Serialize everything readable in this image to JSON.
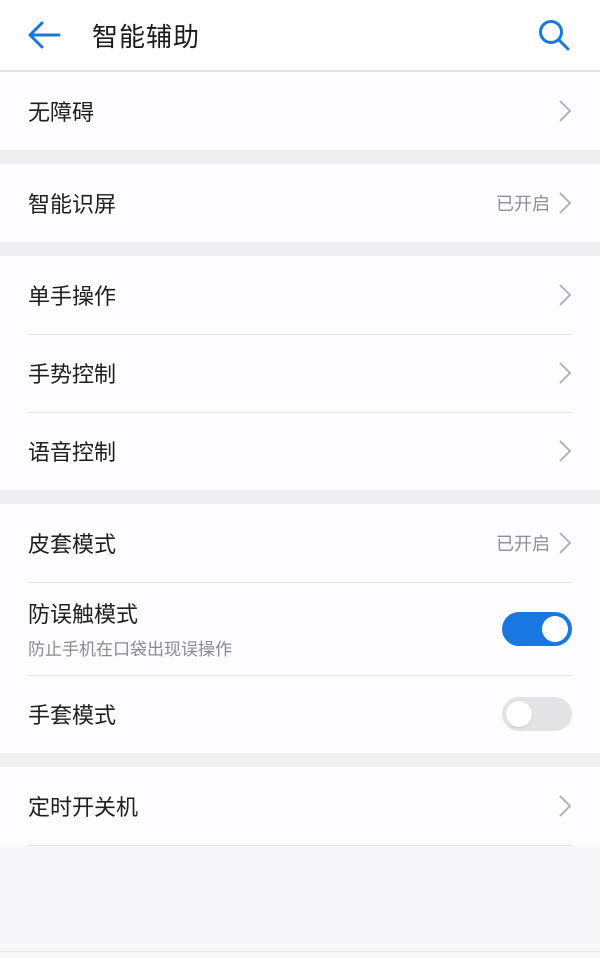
{
  "header": {
    "title": "智能辅助",
    "back_icon": "back-arrow-icon",
    "search_icon": "search-icon",
    "accent_color": "#1877e0"
  },
  "groups": [
    {
      "items": [
        {
          "label": "无障碍"
        }
      ]
    },
    {
      "items": [
        {
          "label": "智能识屏",
          "status": "已开启"
        }
      ]
    },
    {
      "items": [
        {
          "label": "单手操作"
        },
        {
          "label": "手势控制"
        },
        {
          "label": "语音控制"
        }
      ]
    },
    {
      "items": [
        {
          "label": "皮套模式",
          "status": "已开启"
        },
        {
          "label": "防误触模式",
          "sublabel": "防止手机在口袋出现误操作",
          "toggle": true
        },
        {
          "label": "手套模式",
          "toggle": false
        }
      ]
    },
    {
      "items": [
        {
          "label": "定时开关机"
        }
      ]
    }
  ]
}
